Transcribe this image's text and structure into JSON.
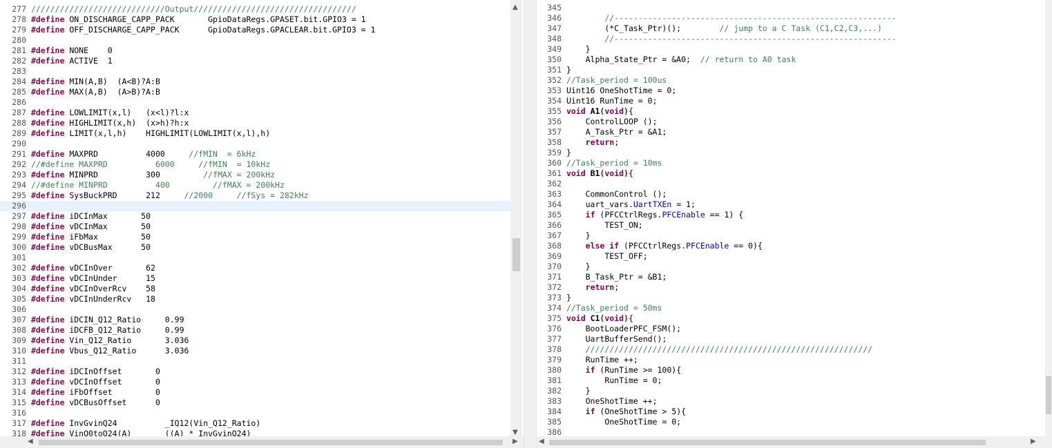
{
  "left": {
    "lines": [
      {
        "n": "277",
        "t": "////////////////////////////Output//////////////////////////////////",
        "cls": "cm"
      },
      {
        "n": "278",
        "pre": "#define",
        "t": " ON_DISCHARGE_CAPP_PACK       GpioDataRegs.GPASET.bit.GPIO3 = 1"
      },
      {
        "n": "279",
        "pre": "#define",
        "t": " OFF_DISCHARGE_CAPP_PACK      GpioDataRegs.GPACLEAR.bit.GPIO3 = 1"
      },
      {
        "n": "280",
        "t": ""
      },
      {
        "n": "281",
        "pre": "#define",
        "t": " NONE    0"
      },
      {
        "n": "282",
        "pre": "#define",
        "t": " ACTIVE  1"
      },
      {
        "n": "283",
        "t": ""
      },
      {
        "n": "284",
        "pre": "#define",
        "t": " MIN(A,B)  (A<B)?A:B"
      },
      {
        "n": "285",
        "pre": "#define",
        "t": " MAX(A,B)  (A>B)?A:B"
      },
      {
        "n": "286",
        "t": ""
      },
      {
        "n": "287",
        "pre": "#define",
        "t": " LOWLIMIT(x,l)   (x<l)?l:x"
      },
      {
        "n": "288",
        "pre": "#define",
        "t": " HIGHLIMIT(x,h)  (x>h)?h:x"
      },
      {
        "n": "289",
        "pre": "#define",
        "t": " LIMIT(x,l,h)    HIGHLIMIT(LOWLIMIT(x,l),h)"
      },
      {
        "n": "290",
        "t": ""
      },
      {
        "n": "291",
        "pre": "#define",
        "t": " MAXPRD          4000     ",
        "c": "//fMIN  = 6kHz"
      },
      {
        "n": "292",
        "t": "//#define MAXPRD          6000     //fMIN  = 10kHz",
        "cls": "cm"
      },
      {
        "n": "293",
        "pre": "#define",
        "t": " MINPRD          300         ",
        "c": "//fMAX = 200kHz"
      },
      {
        "n": "294",
        "t": "//#define MINPRD          400         //fMAX = 200kHz",
        "cls": "cm"
      },
      {
        "n": "295",
        "pre": "#define",
        "t": " SysBuckPRD      212     ",
        "c": "//2000     //fSys = 282kHz"
      },
      {
        "n": "296",
        "t": "",
        "hl": true
      },
      {
        "n": "297",
        "pre": "#define",
        "t": " iDCInMax       50"
      },
      {
        "n": "298",
        "pre": "#define",
        "t": " vDCInMax       50"
      },
      {
        "n": "299",
        "pre": "#define",
        "t": " iFbMax         50"
      },
      {
        "n": "300",
        "pre": "#define",
        "t": " vDCBusMax      50"
      },
      {
        "n": "301",
        "t": ""
      },
      {
        "n": "302",
        "pre": "#define",
        "t": " vDCInOver       62"
      },
      {
        "n": "303",
        "pre": "#define",
        "t": " vDCInUnder      15"
      },
      {
        "n": "304",
        "pre": "#define",
        "t": " vDCInOverRcv    58"
      },
      {
        "n": "305",
        "pre": "#define",
        "t": " vDCInUnderRcv   18"
      },
      {
        "n": "306",
        "t": ""
      },
      {
        "n": "307",
        "pre": "#define",
        "t": " iDCIN_Q12_Ratio     0.99"
      },
      {
        "n": "308",
        "pre": "#define",
        "t": " iDCFB_Q12_Ratio     0.99"
      },
      {
        "n": "309",
        "pre": "#define",
        "t": " Vin_Q12_Ratio       3.036"
      },
      {
        "n": "310",
        "pre": "#define",
        "t": " Vbus_Q12_Ratio      3.036"
      },
      {
        "n": "311",
        "t": ""
      },
      {
        "n": "312",
        "pre": "#define",
        "t": " iDCInOffset       0"
      },
      {
        "n": "313",
        "pre": "#define",
        "t": " vDCInOffset       0"
      },
      {
        "n": "314",
        "pre": "#define",
        "t": " iFbOffset         0"
      },
      {
        "n": "315",
        "pre": "#define",
        "t": " vDCBusOffset      0"
      },
      {
        "n": "316",
        "t": ""
      },
      {
        "n": "317",
        "pre": "#define",
        "t": " InvGvinQ24          _IQ12(Vin_Q12_Ratio)"
      },
      {
        "n": "318",
        "pre": "#define",
        "t": " VinQ0toQ24(A)       ((A) * InvGvinQ24)"
      }
    ]
  },
  "right": {
    "lines": [
      {
        "n": "345",
        "t": ""
      },
      {
        "n": "346",
        "t": "        ",
        "c": "//-----------------------------------------------------------"
      },
      {
        "n": "347",
        "t": "        (*C_Task_Ptr)();        ",
        "c": "// jump to a C Task (C1,C2,C3,...)"
      },
      {
        "n": "348",
        "t": "        ",
        "c": "//-----------------------------------------------------------"
      },
      {
        "n": "349",
        "t": "    }"
      },
      {
        "n": "350",
        "t": "    Alpha_State_Ptr = &A0;  ",
        "c": "// return to A0 task"
      },
      {
        "n": "351",
        "t": "}"
      },
      {
        "n": "352",
        "t": "//Task_period = 100us",
        "cls": "cm"
      },
      {
        "n": "353",
        "t": "Uint16 OneShotTime = 0;"
      },
      {
        "n": "354",
        "t": "Uint16 RunTime = 0;"
      },
      {
        "n": "355",
        "kw": "void",
        "fn": " A1",
        "kw2": "(void)",
        "t": "{"
      },
      {
        "n": "356",
        "t": "    ControlLOOP ();"
      },
      {
        "n": "357",
        "t": "    A_Task_Ptr = &A1;"
      },
      {
        "n": "358",
        "t": "    ",
        "kwEnd": "return",
        "tail": ";"
      },
      {
        "n": "359",
        "t": "}"
      },
      {
        "n": "360",
        "t": "//Task_period = 10ms",
        "cls": "cm"
      },
      {
        "n": "361",
        "kw": "void",
        "fn": " B1",
        "kw2": "(void)",
        "t": "{"
      },
      {
        "n": "362",
        "t": ""
      },
      {
        "n": "363",
        "t": "    CommonControl ();"
      },
      {
        "n": "364",
        "t": "    uart_vars.",
        "fd": "UartTXEn",
        "tail": " = 1;"
      },
      {
        "n": "365",
        "t": "    ",
        "kwEnd": "if",
        "tail": " (PFCCtrlRegs.",
        "fd2": "PFCEnable",
        "tail2": " == 1) {"
      },
      {
        "n": "366",
        "t": "        TEST_ON;"
      },
      {
        "n": "367",
        "t": "    }"
      },
      {
        "n": "368",
        "t": "    ",
        "kwEnd": "else if",
        "tail": " (PFCCtrlRegs.",
        "fd2": "PFCEnable",
        "tail2": " == 0){"
      },
      {
        "n": "369",
        "t": "        TEST_OFF;"
      },
      {
        "n": "370",
        "t": "    }"
      },
      {
        "n": "371",
        "t": "    B_Task_Ptr = &B1;"
      },
      {
        "n": "372",
        "t": "    ",
        "kwEnd": "return",
        "tail": ";"
      },
      {
        "n": "373",
        "t": "}"
      },
      {
        "n": "374",
        "t": "//Task_period = 50ms",
        "cls": "cm"
      },
      {
        "n": "375",
        "kw": "void",
        "fn": " C1",
        "kw2": "(void)",
        "t": "{"
      },
      {
        "n": "376",
        "t": "    BootLoaderPFC_FSM();"
      },
      {
        "n": "377",
        "t": "    UartBufferSend();"
      },
      {
        "n": "378",
        "t": "    ",
        "c": "////////////////////////////////////////////////////////////"
      },
      {
        "n": "379",
        "t": "    RunTime ++;"
      },
      {
        "n": "380",
        "t": "    ",
        "kwEnd": "if",
        "tail": " (RunTime >= 100){"
      },
      {
        "n": "381",
        "t": "        RunTime = 0;"
      },
      {
        "n": "382",
        "t": "    }"
      },
      {
        "n": "383",
        "t": "    OneShotTime ++;"
      },
      {
        "n": "384",
        "t": "    ",
        "kwEnd": "if",
        "tail": " (OneShotTime > 5){"
      },
      {
        "n": "385",
        "t": "        OneShotTime = 0;"
      },
      {
        "n": "386",
        "t": ""
      }
    ]
  },
  "icons": {
    "up": "▲",
    "down": "▼",
    "left": "◀",
    "right": "▶"
  },
  "colors": {
    "directive": "#8b0a50",
    "comment": "#3f7f5f",
    "keyword": "#7f0055",
    "field": "#0000c0",
    "current_line": "#e8f2fe"
  }
}
